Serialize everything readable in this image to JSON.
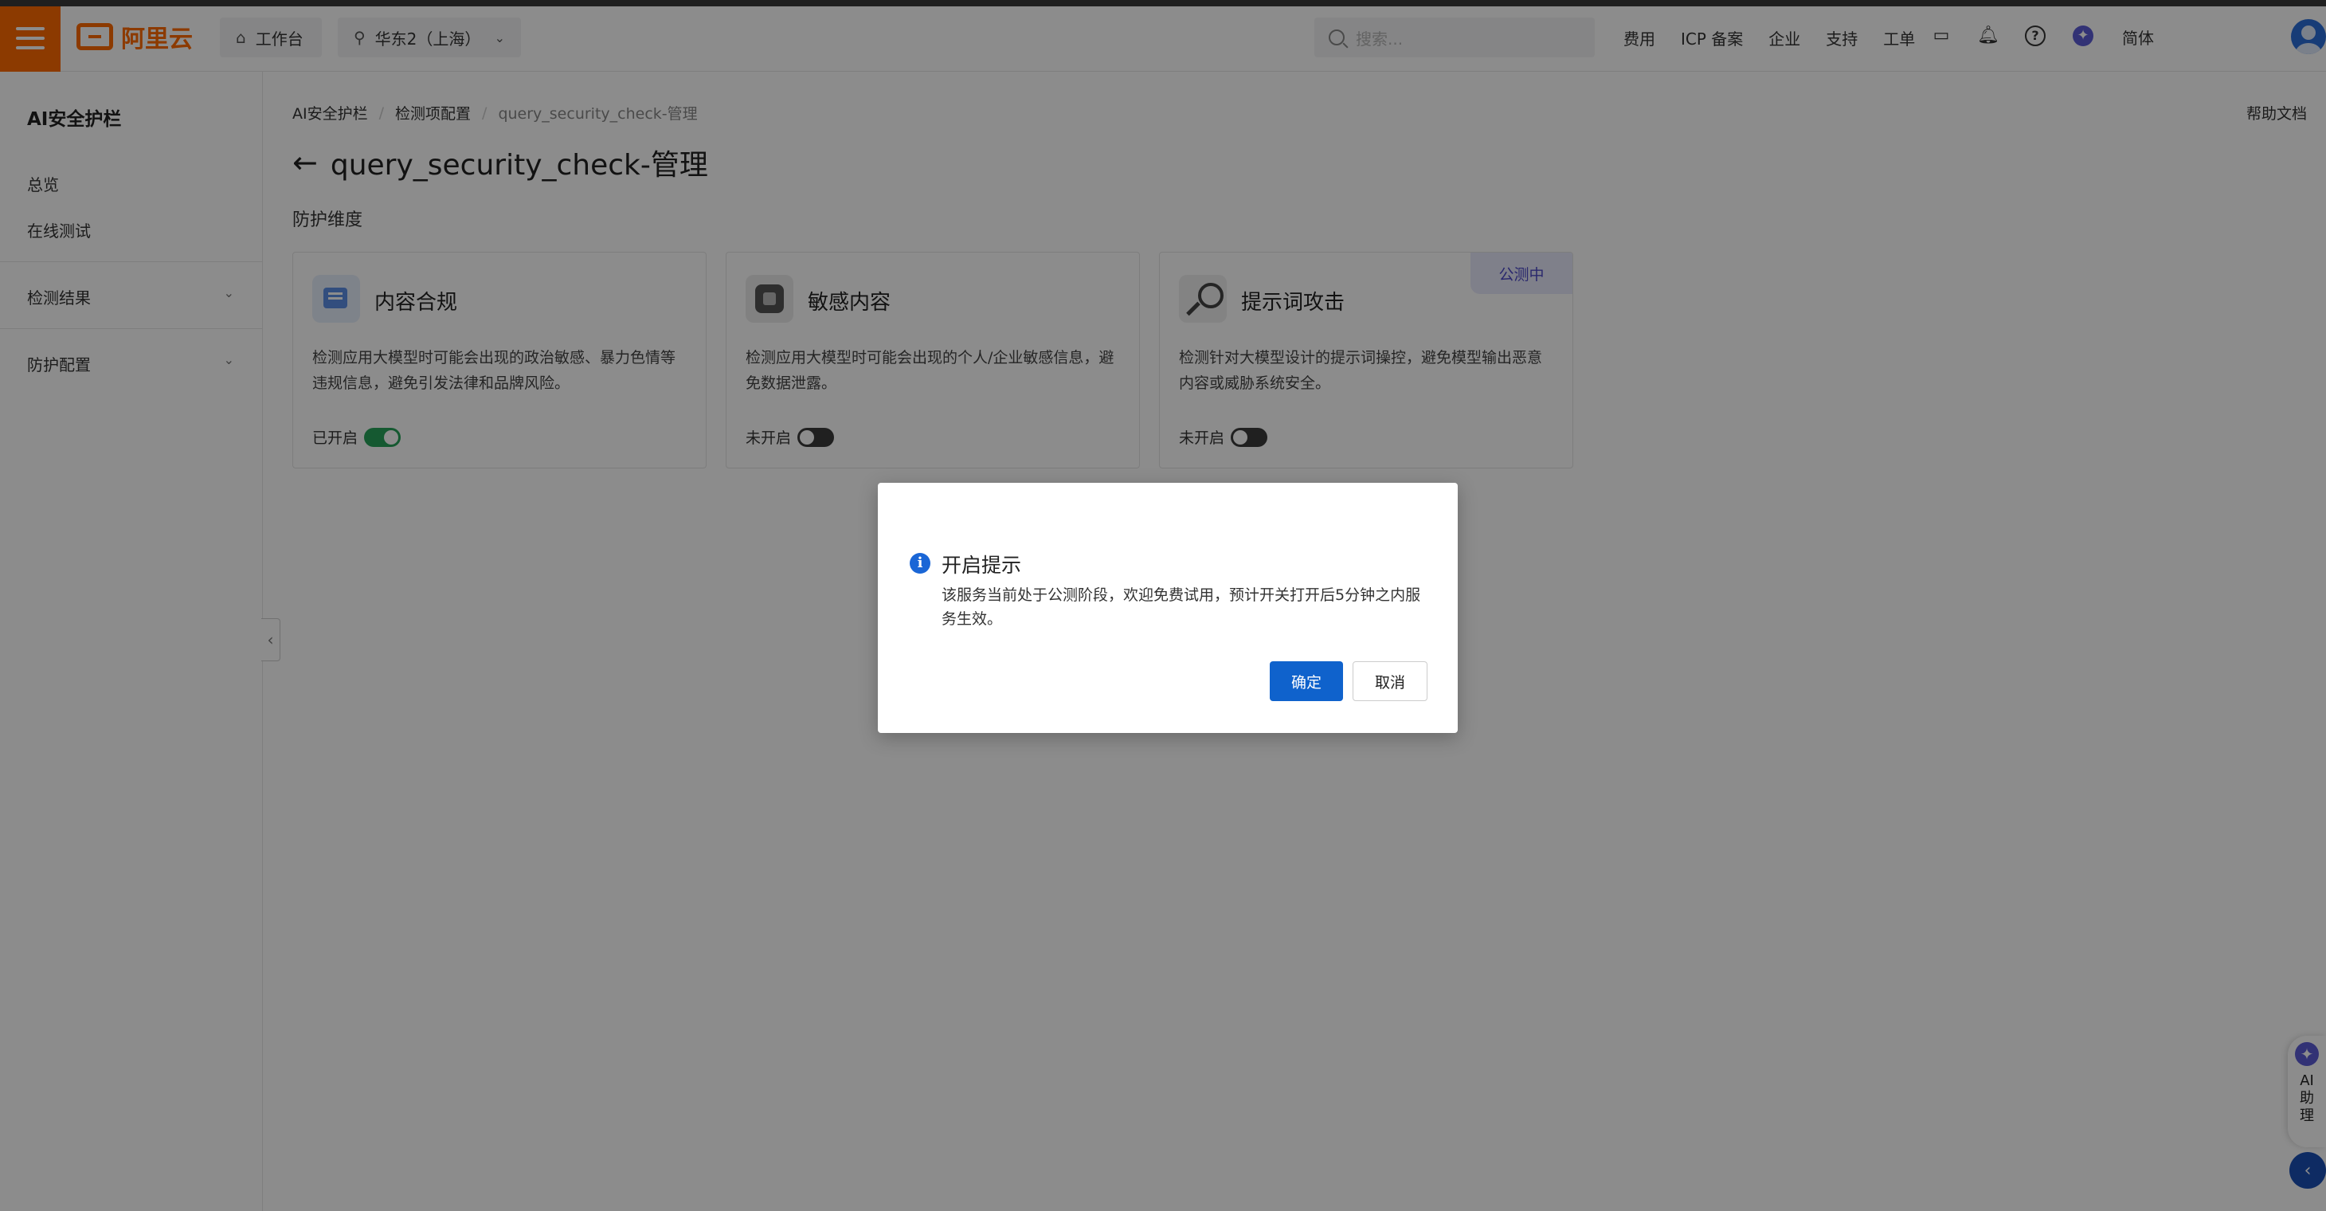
{
  "topbar": {
    "brand": "阿里云",
    "workbench": "工作台",
    "region": "华东2（上海）",
    "search_placeholder": "搜索...",
    "links": [
      "费用",
      "ICP 备案",
      "企业",
      "支持",
      "工单"
    ],
    "language": "简体"
  },
  "sidebar": {
    "title": "AI安全护栏",
    "items": [
      "总览",
      "在线测试"
    ],
    "groups": [
      "检测结果",
      "防护配置"
    ]
  },
  "breadcrumb": [
    "AI安全护栏",
    "检测项配置",
    "query_security_check-管理"
  ],
  "help_doc": "帮助文档",
  "page_title": "query_security_check-管理",
  "section_label": "防护维度",
  "cards": [
    {
      "title": "内容合规",
      "desc": "检测应用大模型时可能会出现的政治敏感、暴力色情等违规信息，避免引发法律和品牌风险。",
      "status": "已开启",
      "enabled": true
    },
    {
      "title": "敏感内容",
      "desc": "检测应用大模型时可能会出现的个人/企业敏感信息，避免数据泄露。",
      "status": "未开启",
      "enabled": false
    },
    {
      "title": "提示词攻击",
      "desc": "检测针对大模型设计的提示词操控，避免模型输出恶意内容或威胁系统安全。",
      "status": "未开启",
      "enabled": false,
      "tag": "公测中"
    }
  ],
  "modal": {
    "title": "开启提示",
    "body": "该服务当前处于公测阶段，欢迎免费试用，预计开关打开后5分钟之内服务生效。",
    "confirm": "确定",
    "cancel": "取消"
  },
  "ai_assistant": {
    "label": "AI助理"
  },
  "colors": {
    "brand_orange": "#ff6a00",
    "primary_blue": "#0f62cc",
    "toggle_on": "#27a35a",
    "beta_purple": "#4b48c7"
  }
}
